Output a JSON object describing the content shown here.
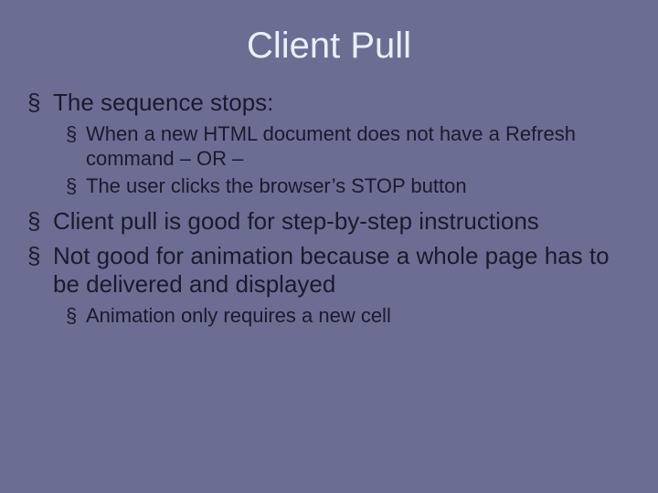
{
  "title": "Client Pull",
  "b1": "The sequence stops:",
  "b1a": "When a new HTML document does not have a Refresh command – OR –",
  "b1b": "The user clicks the browser’s STOP button",
  "b2": "Client pull is good for step-by-step instructions",
  "b3": "Not good for animation because a whole page has to be delivered and displayed",
  "b3a": "Animation only requires a new cell",
  "bullet": "§"
}
